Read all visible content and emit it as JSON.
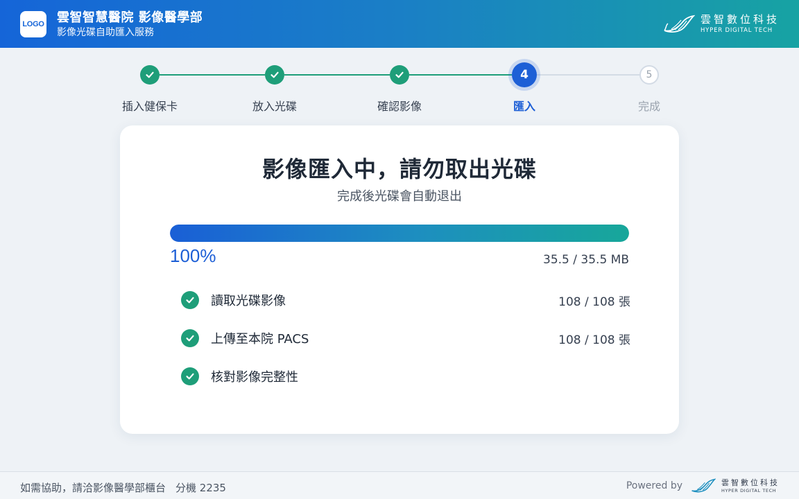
{
  "header": {
    "logo_text": "LOGO",
    "title": "雲智智慧醫院 影像醫學部",
    "subtitle": "影像光碟自助匯入服務",
    "brand_cn": "雲智數位科技",
    "brand_en": "HYPER DIGITAL TECH"
  },
  "stepper": {
    "current_step": 4,
    "steps": [
      {
        "label": "插入健保卡",
        "state": "done"
      },
      {
        "label": "放入光碟",
        "state": "done"
      },
      {
        "label": "確認影像",
        "state": "done"
      },
      {
        "label": "匯入",
        "number": "4",
        "state": "active"
      },
      {
        "label": "完成",
        "number": "5",
        "state": "pending"
      }
    ]
  },
  "card": {
    "title": "影像匯入中，請勿取出光碟",
    "subtitle": "完成後光碟會自動退出",
    "progress": {
      "fraction": 1.0,
      "percent_label": "100%",
      "size_label": "35.5 / 35.5 MB"
    },
    "tasks": [
      {
        "label": "讀取光碟影像",
        "count": "108 / 108 張",
        "status": "done"
      },
      {
        "label": "上傳至本院 PACS",
        "count": "108 / 108 張",
        "status": "done"
      },
      {
        "label": "核對影像完整性",
        "count": "",
        "status": "done"
      }
    ]
  },
  "footer": {
    "help_text": "如需協助，請洽影像醫學部櫃台",
    "extension": "分機 2235",
    "powered_by": "Powered by",
    "brand_cn": "雲智數位科技",
    "brand_en": "HYPER DIGITAL TECH"
  },
  "colors": {
    "primary": "#1d5fd6",
    "success": "#1e9e79",
    "pending": "#d3dbe5",
    "header_gradient_start": "#1565d8",
    "header_gradient_end": "#17a3a3"
  }
}
